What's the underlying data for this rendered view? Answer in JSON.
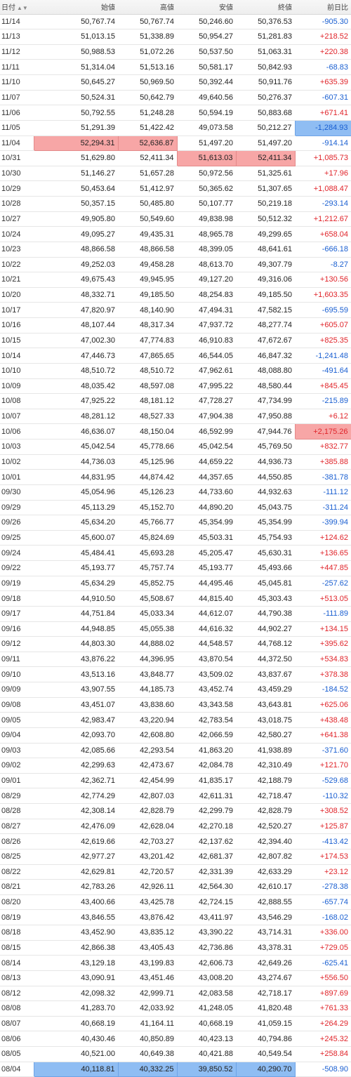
{
  "headers": [
    "日付",
    "始値",
    "高値",
    "安値",
    "終値",
    "前日比"
  ],
  "sort_icon": "sort-arrows-icon",
  "colors": {
    "up": "#e0242a",
    "down": "#1a5fd1",
    "highlight_max": "#f7a6a6",
    "highlight_min": "#8fbdf3"
  },
  "rows": [
    {
      "date": "11/14",
      "open": "50,767.74",
      "high": "50,767.74",
      "low": "50,246.60",
      "close": "50,376.53",
      "change": "-905.30"
    },
    {
      "date": "11/13",
      "open": "51,013.15",
      "high": "51,338.89",
      "low": "50,954.27",
      "close": "51,281.83",
      "change": "+218.52"
    },
    {
      "date": "11/12",
      "open": "50,988.53",
      "high": "51,072.26",
      "low": "50,537.50",
      "close": "51,063.31",
      "change": "+220.38"
    },
    {
      "date": "11/11",
      "open": "51,314.04",
      "high": "51,513.16",
      "low": "50,581.17",
      "close": "50,842.93",
      "change": "-68.83"
    },
    {
      "date": "11/10",
      "open": "50,645.27",
      "high": "50,969.50",
      "low": "50,392.44",
      "close": "50,911.76",
      "change": "+635.39"
    },
    {
      "date": "11/07",
      "open": "50,524.31",
      "high": "50,642.79",
      "low": "49,640.56",
      "close": "50,276.37",
      "change": "-607.31"
    },
    {
      "date": "11/06",
      "open": "50,792.55",
      "high": "51,248.28",
      "low": "50,594.19",
      "close": "50,883.68",
      "change": "+671.41"
    },
    {
      "date": "11/05",
      "open": "51,291.39",
      "high": "51,422.42",
      "low": "49,073.58",
      "close": "50,212.27",
      "change": "-1,284.93",
      "hl": {
        "change": "min"
      }
    },
    {
      "date": "11/04",
      "open": "52,294.31",
      "high": "52,636.87",
      "low": "51,497.20",
      "close": "51,497.20",
      "change": "-914.14",
      "hl": {
        "open": "max",
        "high": "max"
      }
    },
    {
      "date": "10/31",
      "open": "51,629.80",
      "high": "52,411.34",
      "low": "51,613.03",
      "close": "52,411.34",
      "change": "+1,085.73",
      "hl": {
        "low": "max",
        "close": "max"
      }
    },
    {
      "date": "10/30",
      "open": "51,146.27",
      "high": "51,657.28",
      "low": "50,972.56",
      "close": "51,325.61",
      "change": "+17.96"
    },
    {
      "date": "10/29",
      "open": "50,453.64",
      "high": "51,412.97",
      "low": "50,365.62",
      "close": "51,307.65",
      "change": "+1,088.47"
    },
    {
      "date": "10/28",
      "open": "50,357.15",
      "high": "50,485.80",
      "low": "50,107.77",
      "close": "50,219.18",
      "change": "-293.14"
    },
    {
      "date": "10/27",
      "open": "49,905.80",
      "high": "50,549.60",
      "low": "49,838.98",
      "close": "50,512.32",
      "change": "+1,212.67"
    },
    {
      "date": "10/24",
      "open": "49,095.27",
      "high": "49,435.31",
      "low": "48,965.78",
      "close": "49,299.65",
      "change": "+658.04"
    },
    {
      "date": "10/23",
      "open": "48,866.58",
      "high": "48,866.58",
      "low": "48,399.05",
      "close": "48,641.61",
      "change": "-666.18"
    },
    {
      "date": "10/22",
      "open": "49,252.03",
      "high": "49,458.28",
      "low": "48,613.70",
      "close": "49,307.79",
      "change": "-8.27"
    },
    {
      "date": "10/21",
      "open": "49,675.43",
      "high": "49,945.95",
      "low": "49,127.20",
      "close": "49,316.06",
      "change": "+130.56"
    },
    {
      "date": "10/20",
      "open": "48,332.71",
      "high": "49,185.50",
      "low": "48,254.83",
      "close": "49,185.50",
      "change": "+1,603.35"
    },
    {
      "date": "10/17",
      "open": "47,820.97",
      "high": "48,140.90",
      "low": "47,494.31",
      "close": "47,582.15",
      "change": "-695.59"
    },
    {
      "date": "10/16",
      "open": "48,107.44",
      "high": "48,317.34",
      "low": "47,937.72",
      "close": "48,277.74",
      "change": "+605.07"
    },
    {
      "date": "10/15",
      "open": "47,002.30",
      "high": "47,774.83",
      "low": "46,910.83",
      "close": "47,672.67",
      "change": "+825.35"
    },
    {
      "date": "10/14",
      "open": "47,446.73",
      "high": "47,865.65",
      "low": "46,544.05",
      "close": "46,847.32",
      "change": "-1,241.48"
    },
    {
      "date": "10/10",
      "open": "48,510.72",
      "high": "48,510.72",
      "low": "47,962.61",
      "close": "48,088.80",
      "change": "-491.64"
    },
    {
      "date": "10/09",
      "open": "48,035.42",
      "high": "48,597.08",
      "low": "47,995.22",
      "close": "48,580.44",
      "change": "+845.45"
    },
    {
      "date": "10/08",
      "open": "47,925.22",
      "high": "48,181.12",
      "low": "47,728.27",
      "close": "47,734.99",
      "change": "-215.89"
    },
    {
      "date": "10/07",
      "open": "48,281.12",
      "high": "48,527.33",
      "low": "47,904.38",
      "close": "47,950.88",
      "change": "+6.12"
    },
    {
      "date": "10/06",
      "open": "46,636.07",
      "high": "48,150.04",
      "low": "46,592.99",
      "close": "47,944.76",
      "change": "+2,175.26",
      "hl": {
        "change": "max"
      }
    },
    {
      "date": "10/03",
      "open": "45,042.54",
      "high": "45,778.66",
      "low": "45,042.54",
      "close": "45,769.50",
      "change": "+832.77"
    },
    {
      "date": "10/02",
      "open": "44,736.03",
      "high": "45,125.96",
      "low": "44,659.22",
      "close": "44,936.73",
      "change": "+385.88"
    },
    {
      "date": "10/01",
      "open": "44,831.95",
      "high": "44,874.42",
      "low": "44,357.65",
      "close": "44,550.85",
      "change": "-381.78"
    },
    {
      "date": "09/30",
      "open": "45,054.96",
      "high": "45,126.23",
      "low": "44,733.60",
      "close": "44,932.63",
      "change": "-111.12"
    },
    {
      "date": "09/29",
      "open": "45,113.29",
      "high": "45,152.70",
      "low": "44,890.20",
      "close": "45,043.75",
      "change": "-311.24"
    },
    {
      "date": "09/26",
      "open": "45,634.20",
      "high": "45,766.77",
      "low": "45,354.99",
      "close": "45,354.99",
      "change": "-399.94"
    },
    {
      "date": "09/25",
      "open": "45,600.07",
      "high": "45,824.69",
      "low": "45,503.31",
      "close": "45,754.93",
      "change": "+124.62"
    },
    {
      "date": "09/24",
      "open": "45,484.41",
      "high": "45,693.28",
      "low": "45,205.47",
      "close": "45,630.31",
      "change": "+136.65"
    },
    {
      "date": "09/22",
      "open": "45,193.77",
      "high": "45,757.74",
      "low": "45,193.77",
      "close": "45,493.66",
      "change": "+447.85"
    },
    {
      "date": "09/19",
      "open": "45,634.29",
      "high": "45,852.75",
      "low": "44,495.46",
      "close": "45,045.81",
      "change": "-257.62"
    },
    {
      "date": "09/18",
      "open": "44,910.50",
      "high": "45,508.67",
      "low": "44,815.40",
      "close": "45,303.43",
      "change": "+513.05"
    },
    {
      "date": "09/17",
      "open": "44,751.84",
      "high": "45,033.34",
      "low": "44,612.07",
      "close": "44,790.38",
      "change": "-111.89"
    },
    {
      "date": "09/16",
      "open": "44,948.85",
      "high": "45,055.38",
      "low": "44,616.32",
      "close": "44,902.27",
      "change": "+134.15"
    },
    {
      "date": "09/12",
      "open": "44,803.30",
      "high": "44,888.02",
      "low": "44,548.57",
      "close": "44,768.12",
      "change": "+395.62"
    },
    {
      "date": "09/11",
      "open": "43,876.22",
      "high": "44,396.95",
      "low": "43,870.54",
      "close": "44,372.50",
      "change": "+534.83"
    },
    {
      "date": "09/10",
      "open": "43,513.16",
      "high": "43,848.77",
      "low": "43,509.02",
      "close": "43,837.67",
      "change": "+378.38"
    },
    {
      "date": "09/09",
      "open": "43,907.55",
      "high": "44,185.73",
      "low": "43,452.74",
      "close": "43,459.29",
      "change": "-184.52"
    },
    {
      "date": "09/08",
      "open": "43,451.07",
      "high": "43,838.60",
      "low": "43,343.58",
      "close": "43,643.81",
      "change": "+625.06"
    },
    {
      "date": "09/05",
      "open": "42,983.47",
      "high": "43,220.94",
      "low": "42,783.54",
      "close": "43,018.75",
      "change": "+438.48"
    },
    {
      "date": "09/04",
      "open": "42,093.70",
      "high": "42,608.80",
      "low": "42,066.59",
      "close": "42,580.27",
      "change": "+641.38"
    },
    {
      "date": "09/03",
      "open": "42,085.66",
      "high": "42,293.54",
      "low": "41,863.20",
      "close": "41,938.89",
      "change": "-371.60"
    },
    {
      "date": "09/02",
      "open": "42,299.63",
      "high": "42,473.67",
      "low": "42,084.78",
      "close": "42,310.49",
      "change": "+121.70"
    },
    {
      "date": "09/01",
      "open": "42,362.71",
      "high": "42,454.99",
      "low": "41,835.17",
      "close": "42,188.79",
      "change": "-529.68"
    },
    {
      "date": "08/29",
      "open": "42,774.29",
      "high": "42,807.03",
      "low": "42,611.31",
      "close": "42,718.47",
      "change": "-110.32"
    },
    {
      "date": "08/28",
      "open": "42,308.14",
      "high": "42,828.79",
      "low": "42,299.79",
      "close": "42,828.79",
      "change": "+308.52"
    },
    {
      "date": "08/27",
      "open": "42,476.09",
      "high": "42,628.04",
      "low": "42,270.18",
      "close": "42,520.27",
      "change": "+125.87"
    },
    {
      "date": "08/26",
      "open": "42,619.66",
      "high": "42,703.27",
      "low": "42,137.62",
      "close": "42,394.40",
      "change": "-413.42"
    },
    {
      "date": "08/25",
      "open": "42,977.27",
      "high": "43,201.42",
      "low": "42,681.37",
      "close": "42,807.82",
      "change": "+174.53"
    },
    {
      "date": "08/22",
      "open": "42,629.81",
      "high": "42,720.57",
      "low": "42,331.39",
      "close": "42,633.29",
      "change": "+23.12"
    },
    {
      "date": "08/21",
      "open": "42,783.26",
      "high": "42,926.11",
      "low": "42,564.30",
      "close": "42,610.17",
      "change": "-278.38"
    },
    {
      "date": "08/20",
      "open": "43,400.66",
      "high": "43,425.78",
      "low": "42,724.15",
      "close": "42,888.55",
      "change": "-657.74"
    },
    {
      "date": "08/19",
      "open": "43,846.55",
      "high": "43,876.42",
      "low": "43,411.97",
      "close": "43,546.29",
      "change": "-168.02"
    },
    {
      "date": "08/18",
      "open": "43,452.90",
      "high": "43,835.12",
      "low": "43,390.22",
      "close": "43,714.31",
      "change": "+336.00"
    },
    {
      "date": "08/15",
      "open": "42,866.38",
      "high": "43,405.43",
      "low": "42,736.86",
      "close": "43,378.31",
      "change": "+729.05"
    },
    {
      "date": "08/14",
      "open": "43,129.18",
      "high": "43,199.83",
      "low": "42,606.73",
      "close": "42,649.26",
      "change": "-625.41"
    },
    {
      "date": "08/13",
      "open": "43,090.91",
      "high": "43,451.46",
      "low": "43,008.20",
      "close": "43,274.67",
      "change": "+556.50"
    },
    {
      "date": "08/12",
      "open": "42,098.32",
      "high": "42,999.71",
      "low": "42,083.58",
      "close": "42,718.17",
      "change": "+897.69"
    },
    {
      "date": "08/08",
      "open": "41,283.70",
      "high": "42,033.92",
      "low": "41,248.05",
      "close": "41,820.48",
      "change": "+761.33"
    },
    {
      "date": "08/07",
      "open": "40,668.19",
      "high": "41,164.11",
      "low": "40,668.19",
      "close": "41,059.15",
      "change": "+264.29"
    },
    {
      "date": "08/06",
      "open": "40,430.46",
      "high": "40,850.89",
      "low": "40,423.13",
      "close": "40,794.86",
      "change": "+245.32"
    },
    {
      "date": "08/05",
      "open": "40,521.00",
      "high": "40,649.38",
      "low": "40,421.88",
      "close": "40,549.54",
      "change": "+258.84"
    },
    {
      "date": "08/04",
      "open": "40,118.81",
      "high": "40,332.25",
      "low": "39,850.52",
      "close": "40,290.70",
      "change": "-508.90",
      "hl": {
        "open": "min",
        "high": "min",
        "low": "min",
        "close": "min"
      }
    }
  ]
}
